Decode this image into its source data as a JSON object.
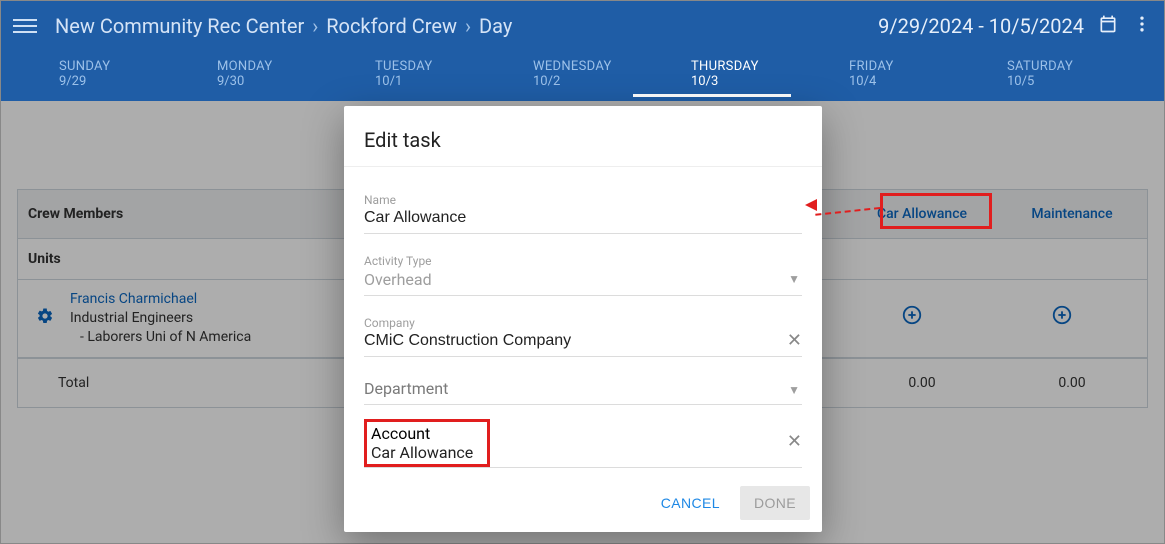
{
  "header": {
    "breadcrumb": [
      "New Community Rec Center",
      "Rockford Crew",
      "Day"
    ],
    "date_range": "9/29/2024 - 10/5/2024"
  },
  "days": [
    {
      "name": "SUNDAY",
      "num": "9/29"
    },
    {
      "name": "MONDAY",
      "num": "9/30"
    },
    {
      "name": "TUESDAY",
      "num": "10/1"
    },
    {
      "name": "WEDNESDAY",
      "num": "10/2"
    },
    {
      "name": "THURSDAY",
      "num": "10/3",
      "active": true
    },
    {
      "name": "FRIDAY",
      "num": "10/4"
    },
    {
      "name": "SATURDAY",
      "num": "10/5"
    }
  ],
  "table": {
    "header_left": "Crew Members",
    "col_car": "Car Allowance",
    "col_maint": "Maintenance",
    "units_label": "Units",
    "employee": {
      "name": "Francis Charmichael",
      "line2": "Industrial Engineers",
      "line3": "- Laborers Uni of N America"
    },
    "total_label": "Total",
    "t_car": "0.00",
    "t_maint": "0.00"
  },
  "modal": {
    "title": "Edit task",
    "name_label": "Name",
    "name_value": "Car Allowance",
    "activity_label": "Activity Type",
    "activity_value": "Overhead",
    "company_label": "Company",
    "company_value": "CMiC Construction Company",
    "department_label": "Department",
    "account_label": "Account",
    "account_value": "Car Allowance",
    "cancel": "CANCEL",
    "done": "DONE"
  }
}
